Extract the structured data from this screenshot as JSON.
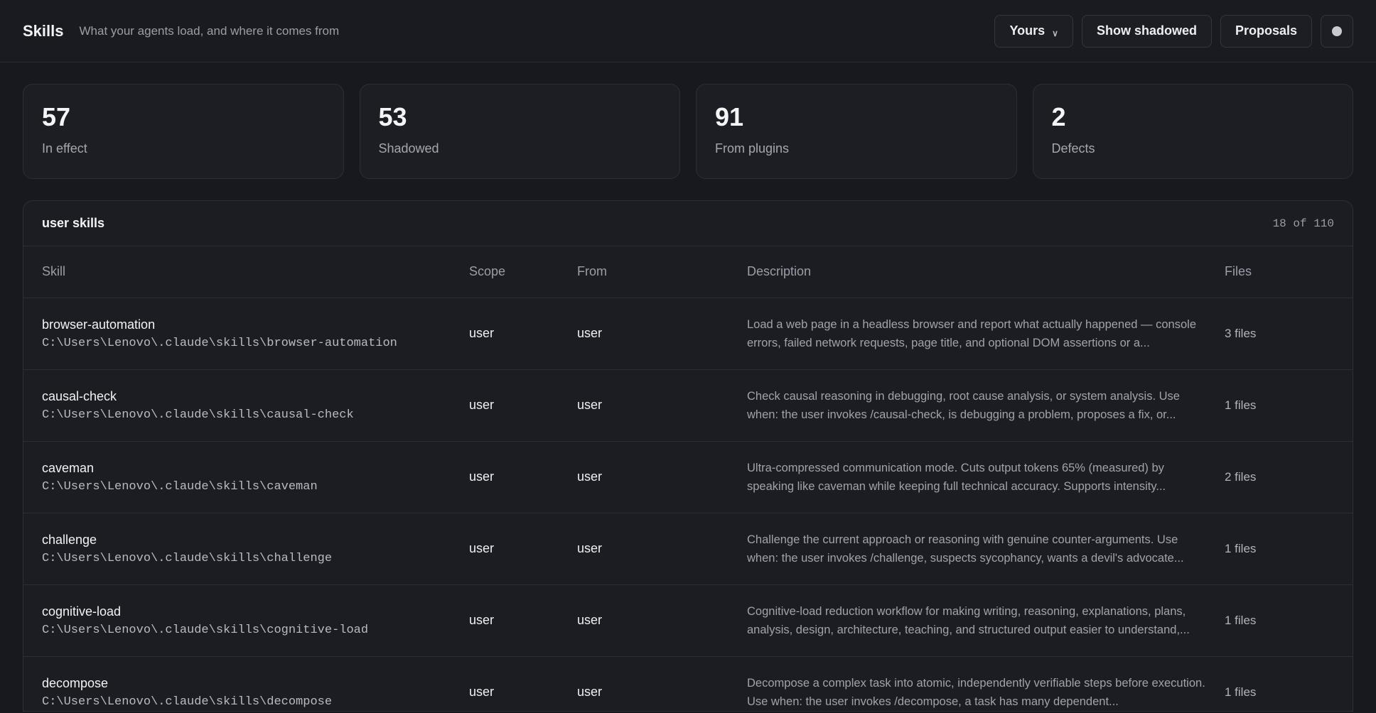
{
  "header": {
    "title": "Skills",
    "subtitle": "What your agents load, and where it comes from",
    "filter_label": "Yours",
    "show_shadowed_label": "Show shadowed",
    "proposals_label": "Proposals"
  },
  "stats": [
    {
      "value": "57",
      "label": "In effect"
    },
    {
      "value": "53",
      "label": "Shadowed"
    },
    {
      "value": "91",
      "label": "From plugins"
    },
    {
      "value": "2",
      "label": "Defects"
    }
  ],
  "panel": {
    "title": "user skills",
    "count": "18 of 110",
    "columns": {
      "skill": "Skill",
      "scope": "Scope",
      "from": "From",
      "description": "Description",
      "files": "Files"
    },
    "rows": [
      {
        "name": "browser-automation",
        "path": "C:\\Users\\Lenovo\\.claude\\skills\\browser-automation",
        "scope": "user",
        "from": "user",
        "description": "Load a web page in a headless browser and report what actually happened — console errors, failed network requests, page title, and optional DOM assertions or a...",
        "files": "3 files"
      },
      {
        "name": "causal-check",
        "path": "C:\\Users\\Lenovo\\.claude\\skills\\causal-check",
        "scope": "user",
        "from": "user",
        "description": "Check causal reasoning in debugging, root cause analysis, or system analysis. Use when: the user invokes /causal-check, is debugging a problem, proposes a fix, or...",
        "files": "1 files"
      },
      {
        "name": "caveman",
        "path": "C:\\Users\\Lenovo\\.claude\\skills\\caveman",
        "scope": "user",
        "from": "user",
        "description": "Ultra-compressed communication mode. Cuts output tokens 65% (measured) by speaking like caveman while keeping full technical accuracy. Supports intensity...",
        "files": "2 files"
      },
      {
        "name": "challenge",
        "path": "C:\\Users\\Lenovo\\.claude\\skills\\challenge",
        "scope": "user",
        "from": "user",
        "description": "Challenge the current approach or reasoning with genuine counter-arguments. Use when: the user invokes /challenge, suspects sycophancy, wants a devil's advocate...",
        "files": "1 files"
      },
      {
        "name": "cognitive-load",
        "path": "C:\\Users\\Lenovo\\.claude\\skills\\cognitive-load",
        "scope": "user",
        "from": "user",
        "description": "Cognitive-load reduction workflow for making writing, reasoning, explanations, plans, analysis, design, architecture, teaching, and structured output easier to understand,...",
        "files": "1 files"
      },
      {
        "name": "decompose",
        "path": "C:\\Users\\Lenovo\\.claude\\skills\\decompose",
        "scope": "user",
        "from": "user",
        "description": "Decompose a complex task into atomic, independently verifiable steps before execution. Use when: the user invokes /decompose, a task has many dependent...",
        "files": "1 files"
      }
    ]
  }
}
